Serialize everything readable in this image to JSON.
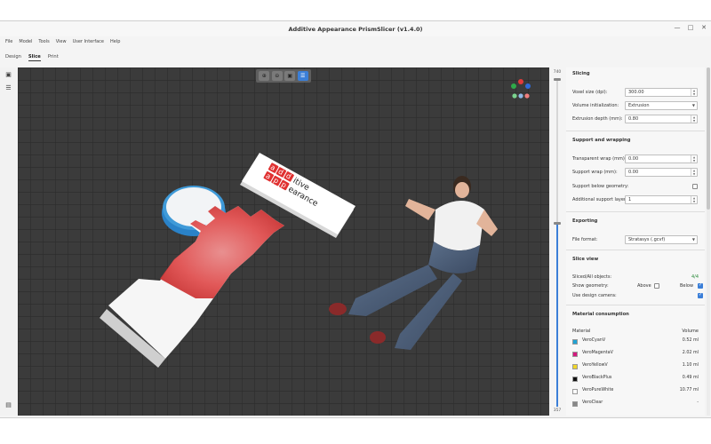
{
  "window": {
    "title": "Additive Appearance PrismSlicer (v1.4.0)",
    "controls": {
      "minimize": "—",
      "maximize": "□",
      "close": "✕"
    }
  },
  "menu": [
    "File",
    "Model",
    "Tools",
    "View",
    "User Interface",
    "Help"
  ],
  "tabs": [
    {
      "label": "Design",
      "active": false
    },
    {
      "label": "Slice",
      "active": true
    },
    {
      "label": "Print",
      "active": false
    }
  ],
  "viewport": {
    "tools": [
      {
        "icon": "zoom-in-icon",
        "glyph": "⊕",
        "active": false
      },
      {
        "icon": "zoom-out-icon",
        "glyph": "⊖",
        "active": false
      },
      {
        "icon": "camera-icon",
        "glyph": "▣",
        "active": false
      },
      {
        "icon": "slice-view-icon",
        "glyph": "☰",
        "active": true
      }
    ],
    "label_text": [
      "a",
      "d",
      "d",
      "itive",
      "a",
      "p",
      "p",
      "earance"
    ],
    "gizmo_colors": [
      "#e23a3a",
      "#2faa4a",
      "#2f6ad8",
      "#8fb9e6",
      "#7ad38e",
      "#f07e7e"
    ]
  },
  "layer_slider": {
    "top": "740",
    "bottom": "357",
    "fraction": 0.56
  },
  "panel": {
    "slicing": {
      "title": "Slicing",
      "voxel_size_label": "Voxel size (dpi):",
      "voxel_size_value": "300.00",
      "volume_init_label": "Volume initialization:",
      "volume_init_value": "Extrusion",
      "extrusion_depth_label": "Extrusion depth (mm):",
      "extrusion_depth_value": "0.80"
    },
    "support": {
      "title": "Support and wrapping",
      "transparent_wrap_label": "Transparent wrap (mm):",
      "transparent_wrap_value": "0.00",
      "support_wrap_label": "Support wrap (mm):",
      "support_wrap_value": "0.00",
      "support_below_label": "Support below geometry:",
      "support_below_checked": false,
      "additional_layers_label": "Additional support layers:",
      "additional_layers_value": "1"
    },
    "exporting": {
      "title": "Exporting",
      "file_format_label": "File format:",
      "file_format_value": "Stratasys (.gcvf)"
    },
    "slice_view": {
      "title": "Slice view",
      "sliced_label": "Sliced/All objects:",
      "sliced_value": "4/4",
      "show_geometry_label": "Show geometry:",
      "above_label": "Above",
      "above_checked": false,
      "below_label": "Below",
      "below_checked": true,
      "design_camera_label": "Use design camera:",
      "design_camera_checked": true
    },
    "material": {
      "title": "Material consumption",
      "col_material": "Material",
      "col_volume": "Volume",
      "rows": [
        {
          "name": "VeroCyanV",
          "volume": "0.52 ml",
          "color": "#1fa3d4"
        },
        {
          "name": "VeroMagentaV",
          "volume": "2.02 ml",
          "color": "#d4197f"
        },
        {
          "name": "VeroYellowV",
          "volume": "1.10 ml",
          "color": "#f0d62a"
        },
        {
          "name": "VeroBlackPlus",
          "volume": "0.49 ml",
          "color": "#111111"
        },
        {
          "name": "VeroPureWhite",
          "volume": "10.77 ml",
          "color": "#ffffff"
        },
        {
          "name": "VeroClear",
          "volume": "-",
          "color": "#888888"
        }
      ]
    }
  }
}
